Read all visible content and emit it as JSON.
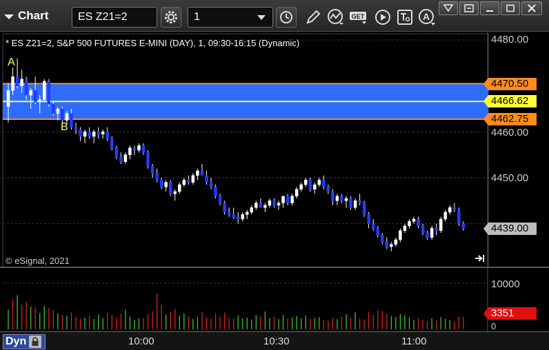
{
  "toolbar": {
    "app_title": "Chart",
    "symbol": "ES Z21=2",
    "interval": "1"
  },
  "chart": {
    "title": "* ES Z21=2, S&P 500 FUTURES E-MINI (DAY), 1, 09:30-16:15 (Dynamic)",
    "copyright": "© eSignal, 2021",
    "annotation_a": "A",
    "annotation_b": "B",
    "colors": {
      "background": "#000000",
      "zone_fill": "#2e6cff",
      "zone_edge": "#ff8c1a",
      "midline": "#ffff3a",
      "up_candle": "#ffffff",
      "down_candle": "#1e3cff",
      "volume_up": "#33cc33",
      "volume_down": "#dd2222"
    }
  },
  "price_axis": {
    "labels": [
      "4480.00",
      "4460.00",
      "4450.00"
    ],
    "last_price_partial": "4439.00",
    "zone_high": "4470.50",
    "zone_mid": "4466.62",
    "zone_low": "4462.75"
  },
  "volume_axis": {
    "labels": [
      "10000",
      "0"
    ],
    "last_volume": "3351"
  },
  "time_axis": {
    "labels": [
      "10:00",
      "10:30",
      "11:00"
    ],
    "mode": "Dyn"
  },
  "chart_data": {
    "type": "candlestick",
    "x_start": "09:30",
    "interval_minutes": 1,
    "candles": [
      [
        4465.5,
        4470.5,
        4462,
        4469
      ],
      [
        4469,
        4474,
        4468,
        4472
      ],
      [
        4472,
        4476,
        4469.5,
        4470
      ],
      [
        4470,
        4473.5,
        4468.5,
        4471.5
      ],
      [
        4471.5,
        4472,
        4467,
        4468
      ],
      [
        4468,
        4469.5,
        4465,
        4469
      ],
      [
        4469,
        4472,
        4466,
        4466.5
      ],
      [
        4466.5,
        4468,
        4464,
        4467
      ],
      [
        4467,
        4471.5,
        4466.5,
        4471
      ],
      [
        4471,
        4471.5,
        4465.5,
        4466
      ],
      [
        4466,
        4466.5,
        4463.5,
        4464
      ],
      [
        4464,
        4465.5,
        4462.5,
        4465
      ],
      [
        4465,
        4465.5,
        4462,
        4462.5
      ],
      [
        4462.5,
        4464.5,
        4461.5,
        4464
      ],
      [
        4464,
        4465,
        4460.5,
        4461
      ],
      [
        4461,
        4462,
        4459.5,
        4460.5
      ],
      [
        4460.5,
        4461,
        4458,
        4459
      ],
      [
        4459,
        4460.5,
        4457.5,
        4460
      ],
      [
        4460,
        4461,
        4458.5,
        4459
      ],
      [
        4459,
        4460.5,
        4457.5,
        4460
      ],
      [
        4460,
        4461,
        4458.5,
        4459.5
      ],
      [
        4459.5,
        4460.5,
        4458.5,
        4460
      ],
      [
        4460,
        4461,
        4458,
        4458.5
      ],
      [
        4458.5,
        4459,
        4456,
        4456.5
      ],
      [
        4456.5,
        4457,
        4454,
        4454.5
      ],
      [
        4454.5,
        4455.5,
        4453,
        4453.5
      ],
      [
        4453.5,
        4455.5,
        4453,
        4455
      ],
      [
        4455,
        4457,
        4454,
        4456.5
      ],
      [
        4456.5,
        4457,
        4455,
        4456
      ],
      [
        4456,
        4457.5,
        4455.5,
        4457
      ],
      [
        4457,
        4457.5,
        4455,
        4455.5
      ],
      [
        4455.5,
        4456,
        4452,
        4452.5
      ],
      [
        4452.5,
        4453,
        4450,
        4451
      ],
      [
        4451,
        4452,
        4449,
        4449.5
      ],
      [
        4449.5,
        4450,
        4447.5,
        4448
      ],
      [
        4448,
        4449.5,
        4447,
        4449
      ],
      [
        4449,
        4449.5,
        4446,
        4446.5
      ],
      [
        4446.5,
        4447.5,
        4445,
        4447
      ],
      [
        4447,
        4449,
        4446.5,
        4448.5
      ],
      [
        4448.5,
        4450,
        4448,
        4449.5
      ],
      [
        4449.5,
        4450.5,
        4448.5,
        4449
      ],
      [
        4449,
        4451,
        4448.5,
        4450.5
      ],
      [
        4450.5,
        4452,
        4449.5,
        4451.5
      ],
      [
        4451.5,
        4453,
        4450.5,
        4450.5
      ],
      [
        4450.5,
        4451.5,
        4448.5,
        4449
      ],
      [
        4449,
        4450,
        4447.5,
        4448
      ],
      [
        4448,
        4448.5,
        4445.5,
        4446
      ],
      [
        4446,
        4446.5,
        4444,
        4444.5
      ],
      [
        4444.5,
        4445,
        4442,
        4442.5
      ],
      [
        4442.5,
        4443.5,
        4441.5,
        4442
      ],
      [
        4442,
        4443.5,
        4441,
        4441.5
      ],
      [
        4441.5,
        4442.5,
        4440,
        4441
      ],
      [
        4441,
        4442.5,
        4440.5,
        4442
      ],
      [
        4442,
        4443,
        4441,
        4442.5
      ],
      [
        4442.5,
        4444,
        4442,
        4443.5
      ],
      [
        4443.5,
        4445,
        4443,
        4444.5
      ],
      [
        4444.5,
        4445.5,
        4443.5,
        4443.5
      ],
      [
        4443.5,
        4444.5,
        4442.5,
        4444
      ],
      [
        4444,
        4445.5,
        4443.5,
        4445
      ],
      [
        4445,
        4445.5,
        4443.5,
        4444
      ],
      [
        4444,
        4445,
        4443,
        4444.5
      ],
      [
        4444.5,
        4446,
        4443.5,
        4446
      ],
      [
        4446,
        4446.5,
        4444,
        4444.5
      ],
      [
        4444.5,
        4446.5,
        4444,
        4446
      ],
      [
        4446,
        4448,
        4445.5,
        4447.5
      ],
      [
        4447.5,
        4449,
        4447,
        4448.5
      ],
      [
        4448.5,
        4450,
        4448,
        4449.5
      ],
      [
        4449.5,
        4450,
        4447,
        4447.5
      ],
      [
        4447.5,
        4449,
        4446.5,
        4448.5
      ],
      [
        4448.5,
        4450,
        4448,
        4449.5
      ],
      [
        4449.5,
        4450.5,
        4447.5,
        4448
      ],
      [
        4448,
        4448.5,
        4446.5,
        4447
      ],
      [
        4447,
        4447.5,
        4444,
        4445
      ],
      [
        4445,
        4446.5,
        4444,
        4446
      ],
      [
        4446,
        4446.5,
        4444.5,
        4445
      ],
      [
        4445,
        4446,
        4443.5,
        4445.5
      ],
      [
        4445.5,
        4446,
        4443,
        4443.5
      ],
      [
        4443.5,
        4445.5,
        4443,
        4445
      ],
      [
        4445,
        4446.5,
        4444,
        4444.5
      ],
      [
        4444.5,
        4445,
        4441.5,
        4442
      ],
      [
        4442,
        4442.5,
        4439,
        4440
      ],
      [
        4440,
        4441,
        4438.5,
        4439
      ],
      [
        4439,
        4439.5,
        4437,
        4437.5
      ],
      [
        4437.5,
        4438,
        4435.5,
        4436
      ],
      [
        4436,
        4437,
        4434.5,
        4435
      ],
      [
        4435,
        4436,
        4434,
        4435.5
      ],
      [
        4435.5,
        4437,
        4435,
        4436.5
      ],
      [
        4436.5,
        4439,
        4436,
        4438.5
      ],
      [
        4438.5,
        4440,
        4438,
        4439.5
      ],
      [
        4439.5,
        4441,
        4439,
        4440.5
      ],
      [
        4440.5,
        4441.5,
        4440,
        4441
      ],
      [
        4441,
        4441.5,
        4439,
        4439.5
      ],
      [
        4439.5,
        4440,
        4437.5,
        4438
      ],
      [
        4438,
        4438.5,
        4436.5,
        4437
      ],
      [
        4437,
        4439.5,
        4436.5,
        4439
      ],
      [
        4439,
        4440,
        4437.5,
        4438.5
      ],
      [
        4438.5,
        4441.5,
        4438,
        4441
      ],
      [
        4441,
        4443,
        4440.5,
        4442.5
      ],
      [
        4442.5,
        4444,
        4442,
        4443.5
      ],
      [
        4443.5,
        4444.5,
        4442.5,
        4443
      ],
      [
        4443,
        4443.5,
        4439.5,
        4440
      ],
      [
        4440,
        4440.5,
        4438.5,
        4439
      ]
    ],
    "volume": [
      [
        5200,
        1
      ],
      [
        7800,
        0
      ],
      [
        9000,
        1
      ],
      [
        6500,
        0
      ],
      [
        7200,
        0
      ],
      [
        6000,
        1
      ],
      [
        5800,
        0
      ],
      [
        4300,
        1
      ],
      [
        6100,
        1
      ],
      [
        5700,
        0
      ],
      [
        5000,
        0
      ],
      [
        4200,
        1
      ],
      [
        3800,
        0
      ],
      [
        3600,
        1
      ],
      [
        4500,
        0
      ],
      [
        3300,
        0
      ],
      [
        2800,
        0
      ],
      [
        3100,
        1
      ],
      [
        3500,
        0
      ],
      [
        2700,
        1
      ],
      [
        3900,
        1
      ],
      [
        3000,
        1
      ],
      [
        4400,
        0
      ],
      [
        3800,
        0
      ],
      [
        3000,
        0
      ],
      [
        4200,
        0
      ],
      [
        5200,
        1
      ],
      [
        3300,
        1
      ],
      [
        2500,
        1
      ],
      [
        2900,
        1
      ],
      [
        3000,
        0
      ],
      [
        4100,
        0
      ],
      [
        4800,
        0
      ],
      [
        9500,
        0
      ],
      [
        6500,
        0
      ],
      [
        3900,
        1
      ],
      [
        4700,
        0
      ],
      [
        5400,
        0
      ],
      [
        3600,
        1
      ],
      [
        4200,
        1
      ],
      [
        3400,
        0
      ],
      [
        2800,
        1
      ],
      [
        3200,
        1
      ],
      [
        4600,
        0
      ],
      [
        3100,
        0
      ],
      [
        2800,
        0
      ],
      [
        4200,
        0
      ],
      [
        3400,
        0
      ],
      [
        4400,
        0
      ],
      [
        3000,
        0
      ],
      [
        2800,
        0
      ],
      [
        3600,
        1
      ],
      [
        2900,
        1
      ],
      [
        3100,
        1
      ],
      [
        2600,
        1
      ],
      [
        3800,
        1
      ],
      [
        3400,
        0
      ],
      [
        4700,
        1
      ],
      [
        3000,
        1
      ],
      [
        3300,
        0
      ],
      [
        2700,
        1
      ],
      [
        3800,
        1
      ],
      [
        2800,
        0
      ],
      [
        3100,
        1
      ],
      [
        3500,
        1
      ],
      [
        2900,
        1
      ],
      [
        3600,
        1
      ],
      [
        2800,
        0
      ],
      [
        3000,
        1
      ],
      [
        3200,
        1
      ],
      [
        2500,
        0
      ],
      [
        2300,
        0
      ],
      [
        3000,
        0
      ],
      [
        2700,
        1
      ],
      [
        3400,
        0
      ],
      [
        4000,
        1
      ],
      [
        3100,
        0
      ],
      [
        4500,
        1
      ],
      [
        2800,
        0
      ],
      [
        2600,
        0
      ],
      [
        4700,
        0
      ],
      [
        3800,
        0
      ],
      [
        5000,
        0
      ],
      [
        4800,
        0
      ],
      [
        4000,
        0
      ],
      [
        3500,
        1
      ],
      [
        3300,
        1
      ],
      [
        4000,
        1
      ],
      [
        3700,
        1
      ],
      [
        3100,
        1
      ],
      [
        2400,
        1
      ],
      [
        3000,
        0
      ],
      [
        2600,
        0
      ],
      [
        2200,
        0
      ],
      [
        2900,
        1
      ],
      [
        2400,
        0
      ],
      [
        3200,
        1
      ],
      [
        2800,
        1
      ],
      [
        2500,
        1
      ],
      [
        2200,
        0
      ],
      [
        3400,
        0
      ],
      [
        3351,
        0
      ]
    ]
  }
}
